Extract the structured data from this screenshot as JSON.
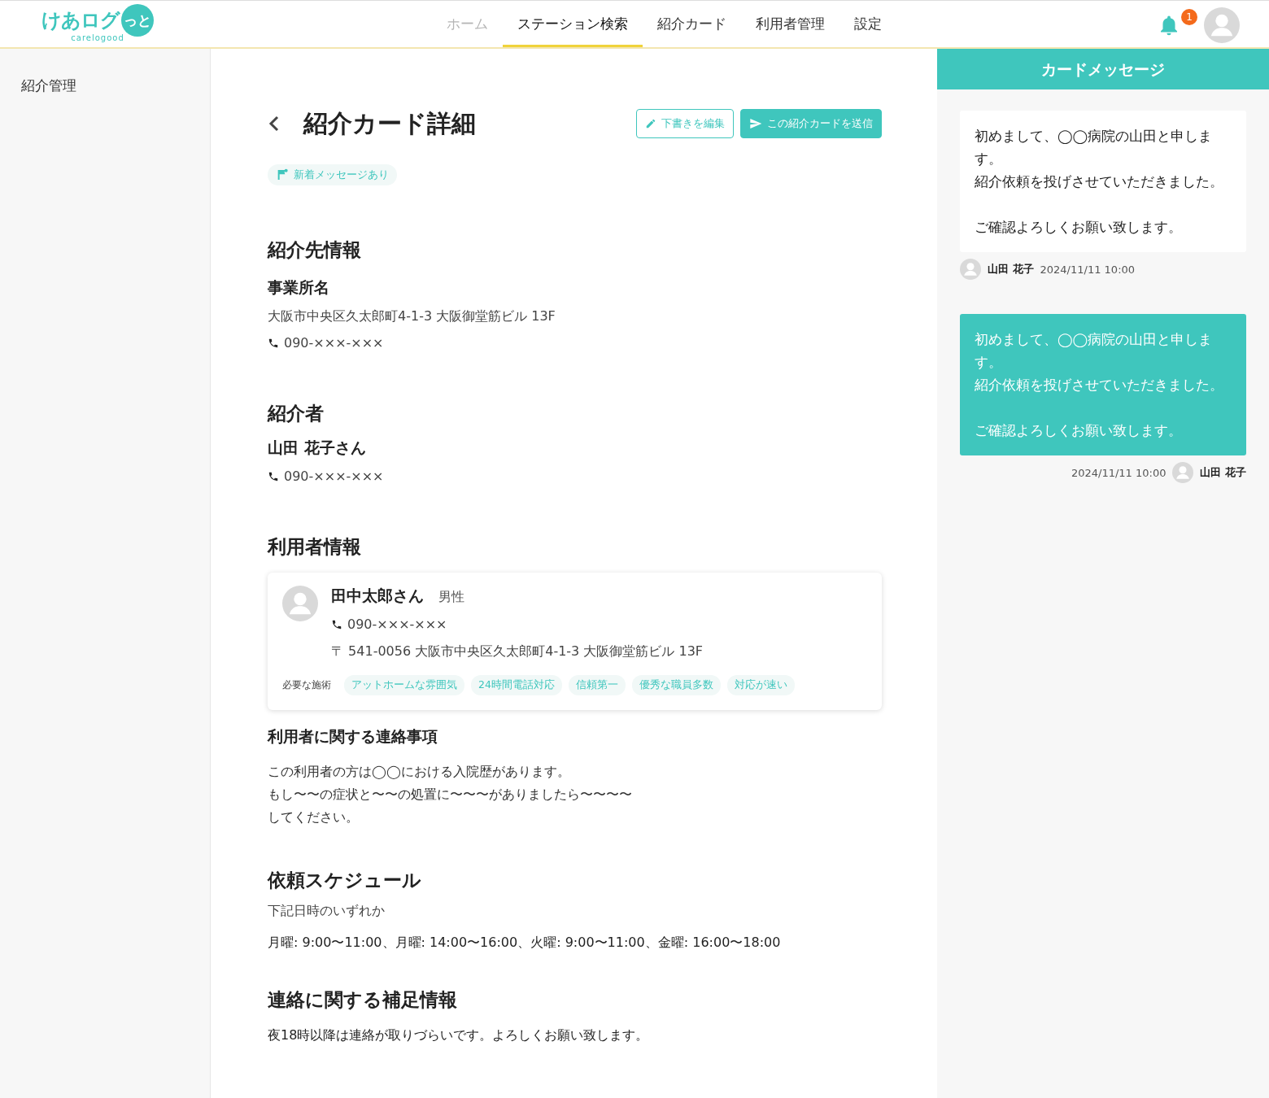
{
  "header": {
    "logo": {
      "main": "けあログ",
      "accent": "っと",
      "sub": "carelogood"
    },
    "nav": [
      {
        "label": "ホーム",
        "selected": false,
        "disabled": true
      },
      {
        "label": "ステーション検索",
        "selected": true,
        "disabled": false
      },
      {
        "label": "紹介カード",
        "selected": false,
        "disabled": false
      },
      {
        "label": "利用者管理",
        "selected": false,
        "disabled": false
      },
      {
        "label": "設定",
        "selected": false,
        "disabled": false
      }
    ],
    "notification_count": "1"
  },
  "sidebar": {
    "items": [
      {
        "label": "紹介管理",
        "selected": false
      }
    ]
  },
  "page": {
    "title": "紹介カード詳細",
    "buttons": [
      {
        "label": "下書きを編集",
        "kind": "outline"
      },
      {
        "label": "この紹介カードを送信",
        "kind": "primary"
      }
    ],
    "status_badge": "新着メッセージあり",
    "destination": {
      "heading": "紹介先情報",
      "label": "事業所名",
      "address": "大阪市中央区久太郎町4-1-3 大阪御堂筋ビル 13F",
      "phone": "090-×××-×××"
    },
    "referrer": {
      "heading": "紹介者",
      "name": "山田 花子さん",
      "phone": "090-×××-×××"
    },
    "user": {
      "heading": "利用者情報",
      "name": "田中太郎さん",
      "gender": "男性",
      "phone": "090-×××-×××",
      "address": "〒 541-0056 大阪市中央区久太郎町4-1-3 大阪御堂筋ビル 13F",
      "tags_label": "必要な施術",
      "tags": [
        "アットホームな雰囲気",
        "24時間電話対応",
        "信頼第一",
        "優秀な職員多数",
        "対応が速い"
      ]
    },
    "notes": {
      "heading": "利用者に関する連絡事項",
      "lines": [
        "この利用者の方は◯◯における入院歴があります。",
        "もし〜〜の症状と〜〜の処置に〜〜〜がありましたら〜〜〜〜",
        "してください。"
      ]
    },
    "schedule": {
      "heading": "依頼スケジュール",
      "hint": "下記日時のいずれか",
      "text": "月曜: 9:00〜11:00、月曜: 14:00〜16:00、火曜: 9:00〜11:00、金曜: 16:00〜18:00"
    },
    "contact": {
      "heading": "連絡に関する補足情報",
      "text": "夜18時以降は連絡が取りづらいです。よろしくお願い致します。"
    }
  },
  "messages": {
    "title": "カードメッセージ",
    "items": [
      {
        "kind": "received",
        "paragraphs": [
          [
            "初めまして、◯◯病院の山田と申します。",
            "紹介依頼を投げさせていただきました。"
          ],
          [
            "ご確認よろしくお願い致します。"
          ]
        ],
        "author": "山田 花子",
        "time": "2024/11/11 10:00"
      },
      {
        "kind": "sent",
        "paragraphs": [
          [
            "初めまして、◯◯病院の山田と申します。",
            "紹介依頼を投げさせていただきました。"
          ],
          [
            "ご確認よろしくお願い致します。"
          ]
        ],
        "author": "山田 花子",
        "time": "2024/11/11 10:00"
      }
    ]
  }
}
